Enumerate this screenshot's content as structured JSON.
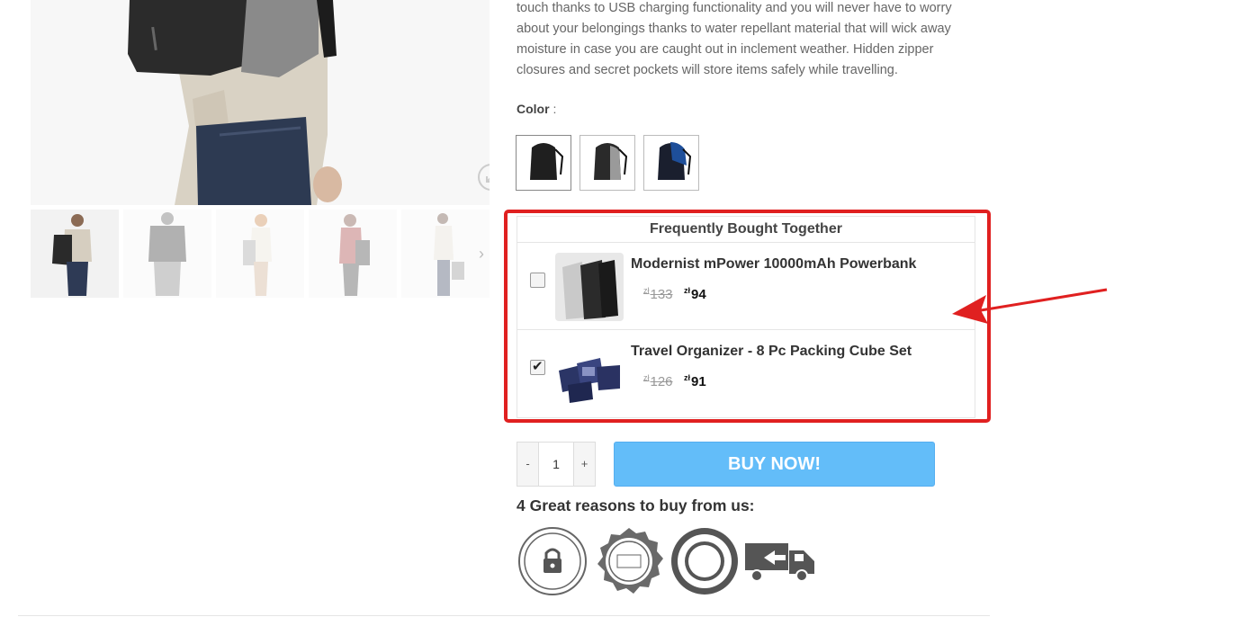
{
  "product": {
    "description": "touch thanks to USB charging functionality and you will never have to worry about your belongings thanks to water repellant material that will wick away moisture in case you are caught out in inclement weather. Hidden zipper closures and secret pockets will store items safely while travelling.",
    "color_label": "Color",
    "color_sep": " :",
    "colors": [
      "black",
      "grey",
      "blue"
    ]
  },
  "fbt": {
    "title": "Frequently Bought Together",
    "currency": "zł",
    "items": [
      {
        "name": "Modernist mPower 10000mAh Powerbank",
        "old_price": "133",
        "new_price": "94",
        "checked": false
      },
      {
        "name": "Travel Organizer - 8 Pc Packing Cube Set",
        "old_price": "126",
        "new_price": "91",
        "checked": true
      }
    ]
  },
  "cart": {
    "minus": "-",
    "plus": "+",
    "qty": "1",
    "buy_label": "BUY NOW!"
  },
  "reasons": {
    "title": "4 Great reasons to buy from us:",
    "badges": [
      "secure-ordering",
      "60-day-money-back",
      "satisfaction-guaranteed",
      "easy-returns"
    ]
  },
  "colors": {
    "highlight": "#e02020",
    "buy_button": "#63bdf9"
  }
}
